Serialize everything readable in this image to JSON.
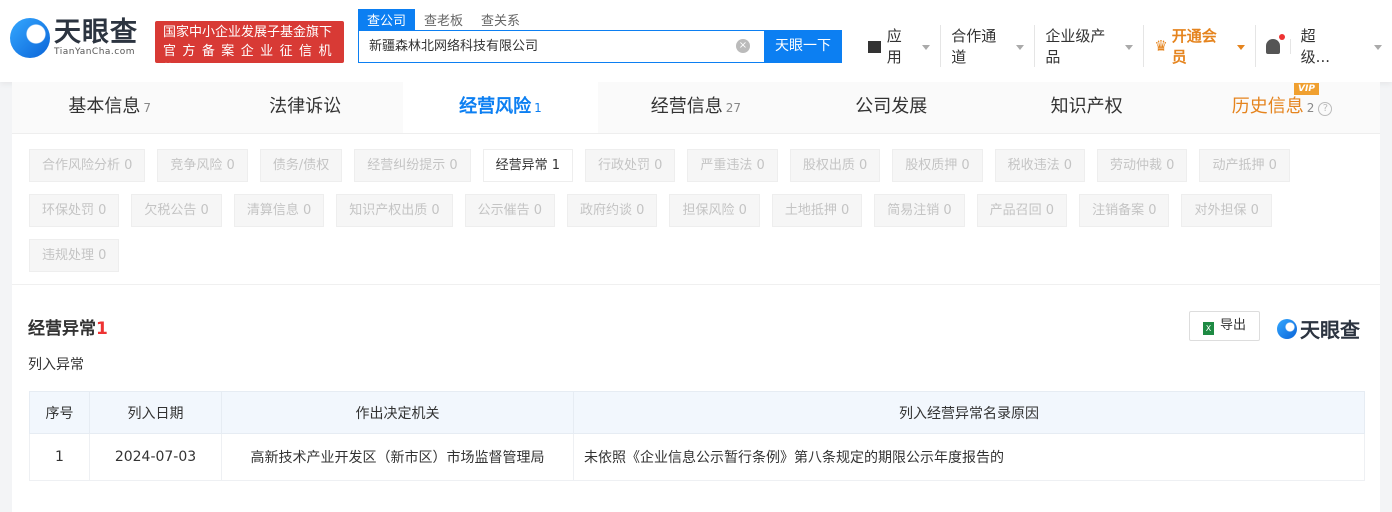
{
  "header": {
    "logo_cn": "天眼查",
    "logo_en": "TianYanCha.com",
    "badge_line1": "国家中小企业发展子基金旗下",
    "badge_line2": "官方备案企业征信机构",
    "search_tabs": [
      "查公司",
      "查老板",
      "查关系"
    ],
    "search_value": "新疆森林北网络科技有限公司",
    "clear_icon": "×",
    "search_button": "天眼一下",
    "nav": {
      "apps": "应用",
      "partner": "合作通道",
      "enterprise": "企业级产品",
      "vip": "开通会员",
      "user": "超级..."
    }
  },
  "tabs": [
    {
      "label": "基本信息",
      "count": "7"
    },
    {
      "label": "法律诉讼",
      "count": ""
    },
    {
      "label": "经营风险",
      "count": "1"
    },
    {
      "label": "经营信息",
      "count": "27"
    },
    {
      "label": "公司发展",
      "count": ""
    },
    {
      "label": "知识产权",
      "count": ""
    },
    {
      "label": "历史信息",
      "count": "2"
    }
  ],
  "vip_badge": "VIP",
  "help_icon": "?",
  "chips": [
    "合作风险分析 0",
    "竞争风险 0",
    "债务/债权",
    "经营纠纷提示 0",
    "经营异常 1",
    "行政处罚 0",
    "严重违法 0",
    "股权出质 0",
    "股权质押 0",
    "税收违法 0",
    "劳动仲裁 0",
    "动产抵押 0",
    "环保处罚 0",
    "欠税公告 0",
    "清算信息 0",
    "知识产权出质 0",
    "公示催告 0",
    "政府约谈 0",
    "担保风险 0",
    "土地抵押 0",
    "简易注销 0",
    "产品召回 0",
    "注销备案 0",
    "对外担保 0",
    "违规处理 0"
  ],
  "section": {
    "title": "经营异常",
    "count": "1",
    "subtitle": "列入异常",
    "export": "导出",
    "xls": "X",
    "brand": "天眼查"
  },
  "table": {
    "headers": [
      "序号",
      "列入日期",
      "作出决定机关",
      "列入经营异常名录原因"
    ],
    "rows": [
      [
        "1",
        "2024-07-03",
        "高新技术产业开发区（新市区）市场监督管理局",
        "未依照《企业信息公示暂行条例》第八条规定的期限公示年度报告的"
      ]
    ]
  }
}
